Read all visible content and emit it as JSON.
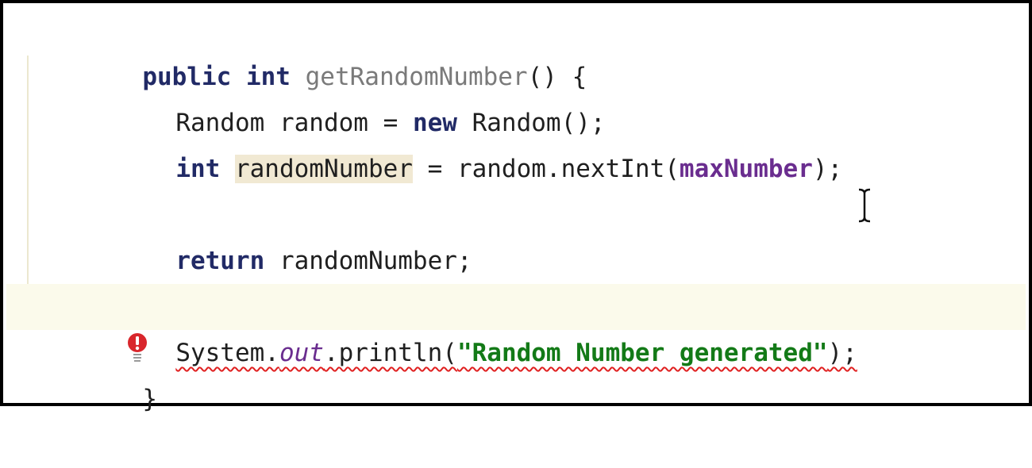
{
  "editor": {
    "language": "Java",
    "lines": [
      {
        "tokens": [
          {
            "text": "public",
            "kind": "keyword"
          },
          {
            "text": " ",
            "kind": "plain"
          },
          {
            "text": "int",
            "kind": "keyword"
          },
          {
            "text": " ",
            "kind": "plain"
          },
          {
            "text": "getRandomNumber",
            "kind": "method"
          },
          {
            "text": "() {",
            "kind": "plain"
          }
        ]
      },
      {
        "tokens": [
          {
            "text": "Random random = ",
            "kind": "plain"
          },
          {
            "text": "new",
            "kind": "keyword"
          },
          {
            "text": " Random();",
            "kind": "plain"
          }
        ]
      },
      {
        "tokens": [
          {
            "text": "int",
            "kind": "keyword"
          },
          {
            "text": " ",
            "kind": "plain"
          },
          {
            "text": "randomNumber",
            "kind": "highlighted"
          },
          {
            "text": " = random.nextInt(",
            "kind": "plain"
          },
          {
            "text": "maxNumber",
            "kind": "field"
          },
          {
            "text": ");",
            "kind": "plain"
          }
        ]
      },
      {
        "tokens": [
          {
            "text": "return",
            "kind": "keyword"
          },
          {
            "text": " randomNumber;",
            "kind": "plain"
          }
        ]
      },
      {
        "tokens": [
          {
            "text": "System.",
            "kind": "plain"
          },
          {
            "text": "out",
            "kind": "static-field"
          },
          {
            "text": ".println(",
            "kind": "plain"
          },
          {
            "text": "\"Random Number generated\"",
            "kind": "string"
          },
          {
            "text": ");",
            "kind": "plain"
          }
        ],
        "error": true,
        "gutter_icon": "error-bulb-icon"
      },
      {
        "tokens": [
          {
            "text": "}",
            "kind": "plain"
          }
        ]
      }
    ]
  },
  "colors": {
    "keyword": "#212a66",
    "method": "#7a7a7a",
    "field": "#6a2d8f",
    "string": "#137a17",
    "highlight": "#f1e9d3",
    "current_line": "#fbfaeb",
    "error": "#e02020"
  }
}
